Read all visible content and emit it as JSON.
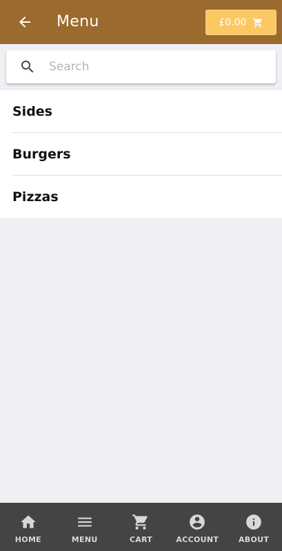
{
  "header": {
    "title": "Menu",
    "back_icon": "arrow-left-icon",
    "cart_total": "£0.00",
    "cart_icon": "shopping-cart-icon",
    "bg_color": "#9b6a2e",
    "cart_button_color": "#fbc864"
  },
  "search": {
    "placeholder": "Search",
    "value": "",
    "icon": "search-icon"
  },
  "categories": [
    {
      "label": "Sides"
    },
    {
      "label": "Burgers"
    },
    {
      "label": "Pizzas"
    }
  ],
  "bottom_nav": {
    "items": [
      {
        "label": "HOME",
        "icon": "home-icon"
      },
      {
        "label": "MENU",
        "icon": "menu-icon"
      },
      {
        "label": "CART",
        "icon": "cart-icon"
      },
      {
        "label": "ACCOUNT",
        "icon": "account-icon"
      },
      {
        "label": "ABOUT",
        "icon": "info-icon"
      }
    ]
  }
}
